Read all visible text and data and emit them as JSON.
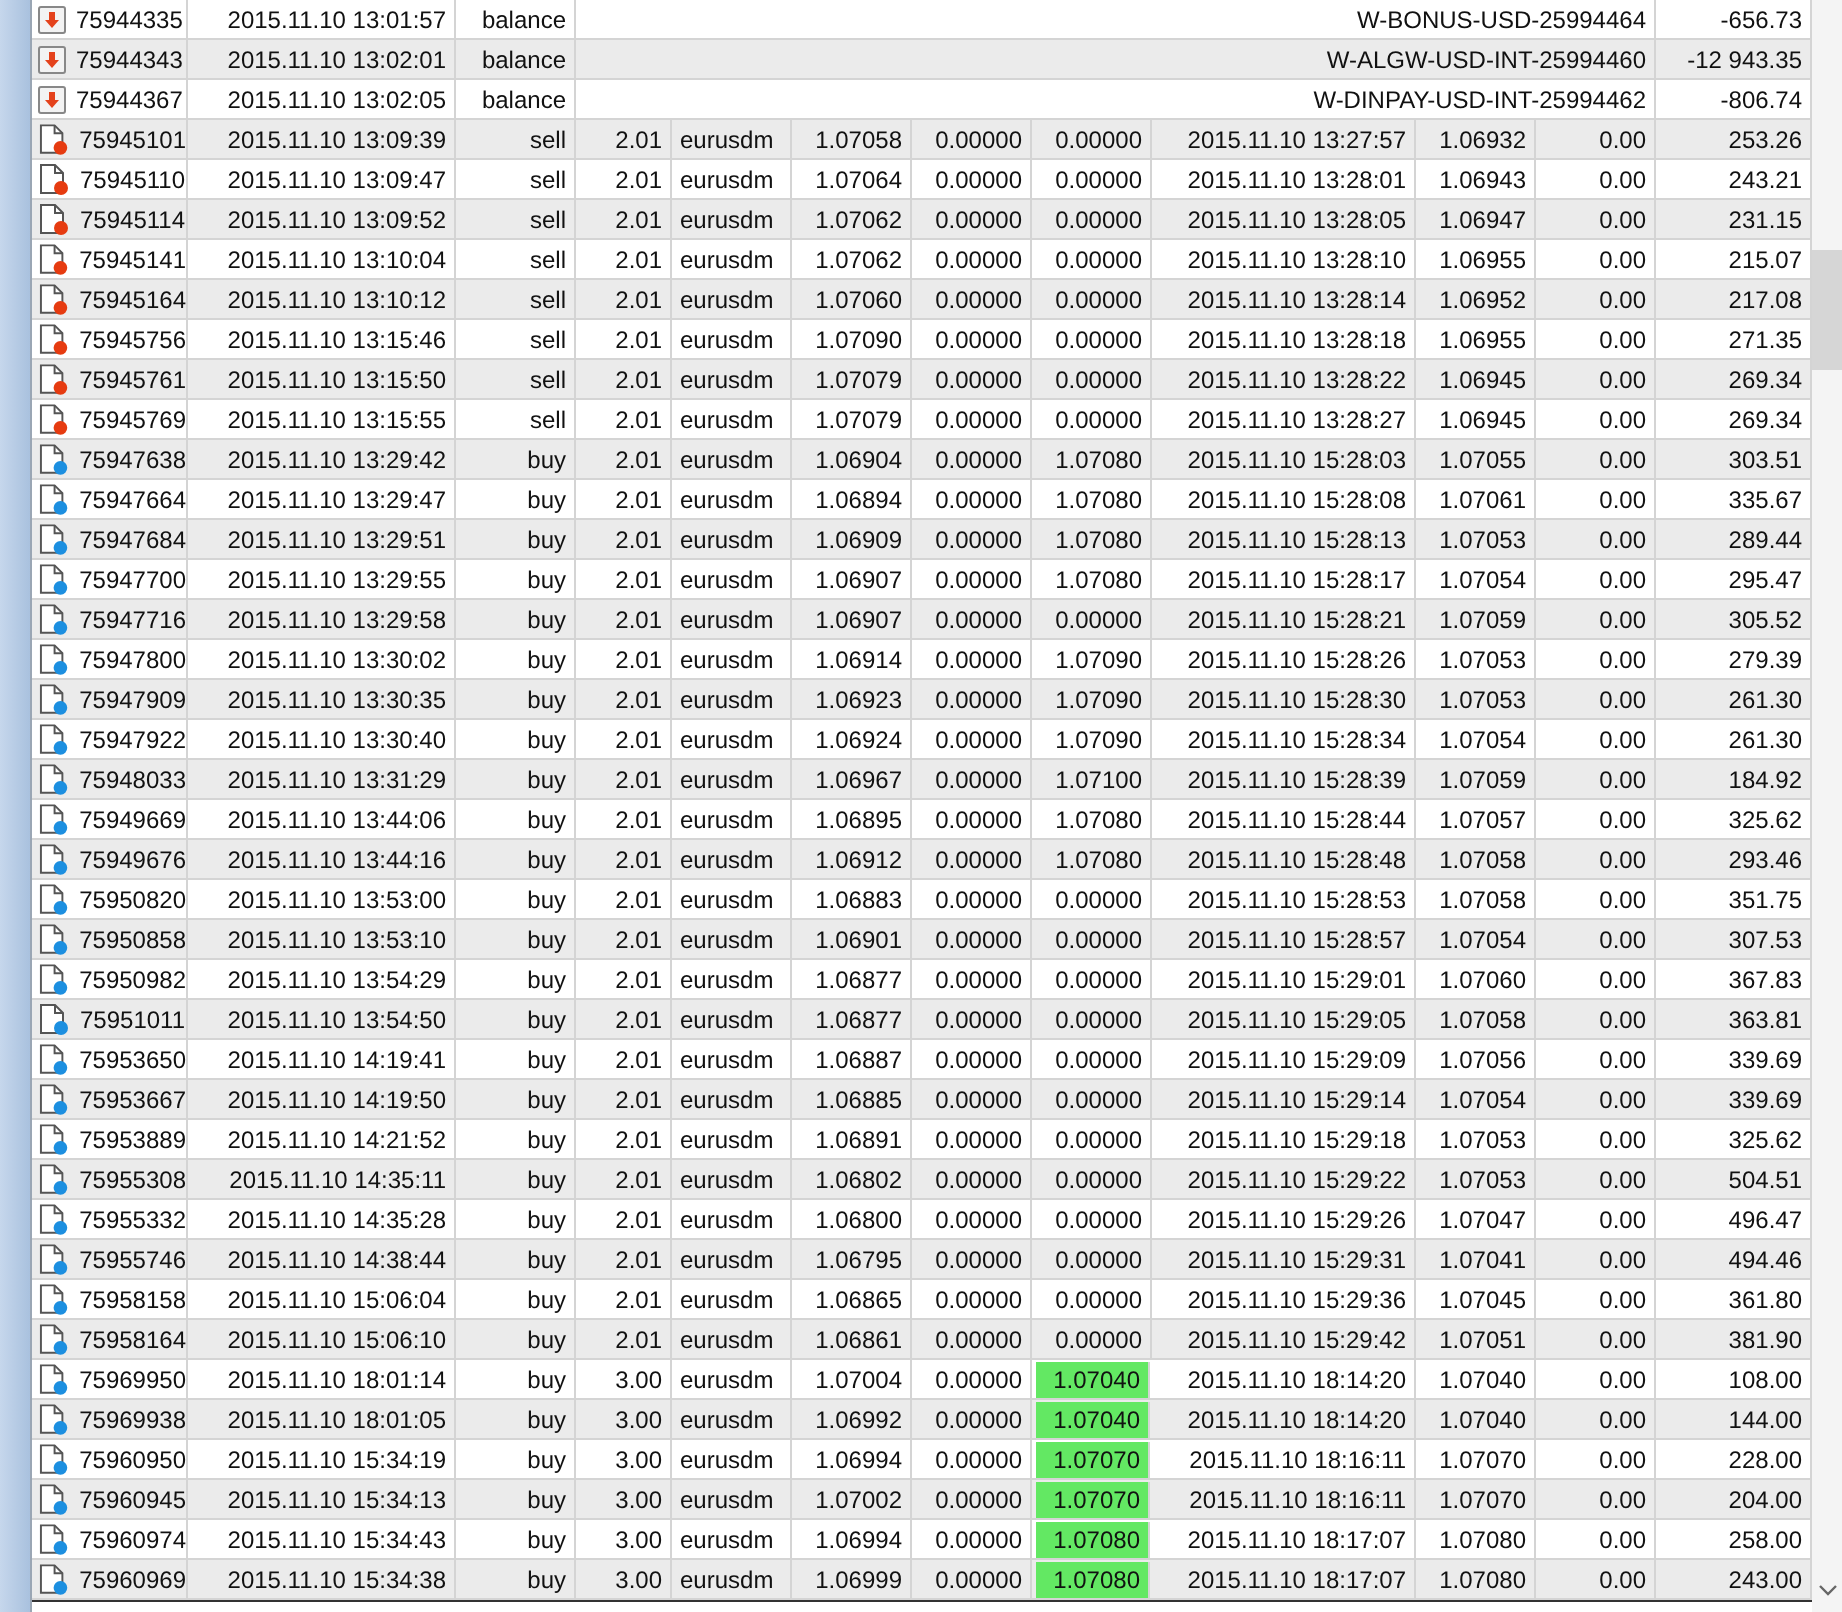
{
  "rows": [
    {
      "kind": "balance",
      "cells": [
        "75944335",
        "2015.11.10 13:01:57",
        "balance",
        "W-BONUS-USD-25994464",
        "-656.73"
      ]
    },
    {
      "kind": "balance",
      "cells": [
        "75944343",
        "2015.11.10 13:02:01",
        "balance",
        "W-ALGW-USD-INT-25994460",
        "-12 943.35"
      ]
    },
    {
      "kind": "balance",
      "cells": [
        "75944367",
        "2015.11.10 13:02:05",
        "balance",
        "W-DINPAY-USD-INT-25994462",
        "-806.74"
      ]
    },
    {
      "kind": "sell",
      "tp_highlighted": false,
      "cells": [
        "75945101",
        "2015.11.10 13:09:39",
        "sell",
        "2.01",
        "eurusdm",
        "1.07058",
        "0.00000",
        "0.00000",
        "2015.11.10 13:27:57",
        "1.06932",
        "0.00",
        "253.26"
      ]
    },
    {
      "kind": "sell",
      "tp_highlighted": false,
      "cells": [
        "75945110",
        "2015.11.10 13:09:47",
        "sell",
        "2.01",
        "eurusdm",
        "1.07064",
        "0.00000",
        "0.00000",
        "2015.11.10 13:28:01",
        "1.06943",
        "0.00",
        "243.21"
      ]
    },
    {
      "kind": "sell",
      "tp_highlighted": false,
      "cells": [
        "75945114",
        "2015.11.10 13:09:52",
        "sell",
        "2.01",
        "eurusdm",
        "1.07062",
        "0.00000",
        "0.00000",
        "2015.11.10 13:28:05",
        "1.06947",
        "0.00",
        "231.15"
      ]
    },
    {
      "kind": "sell",
      "tp_highlighted": false,
      "cells": [
        "75945141",
        "2015.11.10 13:10:04",
        "sell",
        "2.01",
        "eurusdm",
        "1.07062",
        "0.00000",
        "0.00000",
        "2015.11.10 13:28:10",
        "1.06955",
        "0.00",
        "215.07"
      ]
    },
    {
      "kind": "sell",
      "tp_highlighted": false,
      "cells": [
        "75945164",
        "2015.11.10 13:10:12",
        "sell",
        "2.01",
        "eurusdm",
        "1.07060",
        "0.00000",
        "0.00000",
        "2015.11.10 13:28:14",
        "1.06952",
        "0.00",
        "217.08"
      ]
    },
    {
      "kind": "sell",
      "tp_highlighted": false,
      "cells": [
        "75945756",
        "2015.11.10 13:15:46",
        "sell",
        "2.01",
        "eurusdm",
        "1.07090",
        "0.00000",
        "0.00000",
        "2015.11.10 13:28:18",
        "1.06955",
        "0.00",
        "271.35"
      ]
    },
    {
      "kind": "sell",
      "tp_highlighted": false,
      "cells": [
        "75945761",
        "2015.11.10 13:15:50",
        "sell",
        "2.01",
        "eurusdm",
        "1.07079",
        "0.00000",
        "0.00000",
        "2015.11.10 13:28:22",
        "1.06945",
        "0.00",
        "269.34"
      ]
    },
    {
      "kind": "sell",
      "tp_highlighted": false,
      "cells": [
        "75945769",
        "2015.11.10 13:15:55",
        "sell",
        "2.01",
        "eurusdm",
        "1.07079",
        "0.00000",
        "0.00000",
        "2015.11.10 13:28:27",
        "1.06945",
        "0.00",
        "269.34"
      ]
    },
    {
      "kind": "buy",
      "tp_highlighted": false,
      "cells": [
        "75947638",
        "2015.11.10 13:29:42",
        "buy",
        "2.01",
        "eurusdm",
        "1.06904",
        "0.00000",
        "1.07080",
        "2015.11.10 15:28:03",
        "1.07055",
        "0.00",
        "303.51"
      ]
    },
    {
      "kind": "buy",
      "tp_highlighted": false,
      "cells": [
        "75947664",
        "2015.11.10 13:29:47",
        "buy",
        "2.01",
        "eurusdm",
        "1.06894",
        "0.00000",
        "1.07080",
        "2015.11.10 15:28:08",
        "1.07061",
        "0.00",
        "335.67"
      ]
    },
    {
      "kind": "buy",
      "tp_highlighted": false,
      "cells": [
        "75947684",
        "2015.11.10 13:29:51",
        "buy",
        "2.01",
        "eurusdm",
        "1.06909",
        "0.00000",
        "1.07080",
        "2015.11.10 15:28:13",
        "1.07053",
        "0.00",
        "289.44"
      ]
    },
    {
      "kind": "buy",
      "tp_highlighted": false,
      "cells": [
        "75947700",
        "2015.11.10 13:29:55",
        "buy",
        "2.01",
        "eurusdm",
        "1.06907",
        "0.00000",
        "1.07080",
        "2015.11.10 15:28:17",
        "1.07054",
        "0.00",
        "295.47"
      ]
    },
    {
      "kind": "buy",
      "tp_highlighted": false,
      "cells": [
        "75947716",
        "2015.11.10 13:29:58",
        "buy",
        "2.01",
        "eurusdm",
        "1.06907",
        "0.00000",
        "0.00000",
        "2015.11.10 15:28:21",
        "1.07059",
        "0.00",
        "305.52"
      ]
    },
    {
      "kind": "buy",
      "tp_highlighted": false,
      "cells": [
        "75947800",
        "2015.11.10 13:30:02",
        "buy",
        "2.01",
        "eurusdm",
        "1.06914",
        "0.00000",
        "1.07090",
        "2015.11.10 15:28:26",
        "1.07053",
        "0.00",
        "279.39"
      ]
    },
    {
      "kind": "buy",
      "tp_highlighted": false,
      "cells": [
        "75947909",
        "2015.11.10 13:30:35",
        "buy",
        "2.01",
        "eurusdm",
        "1.06923",
        "0.00000",
        "1.07090",
        "2015.11.10 15:28:30",
        "1.07053",
        "0.00",
        "261.30"
      ]
    },
    {
      "kind": "buy",
      "tp_highlighted": false,
      "cells": [
        "75947922",
        "2015.11.10 13:30:40",
        "buy",
        "2.01",
        "eurusdm",
        "1.06924",
        "0.00000",
        "1.07090",
        "2015.11.10 15:28:34",
        "1.07054",
        "0.00",
        "261.30"
      ]
    },
    {
      "kind": "buy",
      "tp_highlighted": false,
      "cells": [
        "75948033",
        "2015.11.10 13:31:29",
        "buy",
        "2.01",
        "eurusdm",
        "1.06967",
        "0.00000",
        "1.07100",
        "2015.11.10 15:28:39",
        "1.07059",
        "0.00",
        "184.92"
      ]
    },
    {
      "kind": "buy",
      "tp_highlighted": false,
      "cells": [
        "75949669",
        "2015.11.10 13:44:06",
        "buy",
        "2.01",
        "eurusdm",
        "1.06895",
        "0.00000",
        "1.07080",
        "2015.11.10 15:28:44",
        "1.07057",
        "0.00",
        "325.62"
      ]
    },
    {
      "kind": "buy",
      "tp_highlighted": false,
      "cells": [
        "75949676",
        "2015.11.10 13:44:16",
        "buy",
        "2.01",
        "eurusdm",
        "1.06912",
        "0.00000",
        "1.07080",
        "2015.11.10 15:28:48",
        "1.07058",
        "0.00",
        "293.46"
      ]
    },
    {
      "kind": "buy",
      "tp_highlighted": false,
      "cells": [
        "75950820",
        "2015.11.10 13:53:00",
        "buy",
        "2.01",
        "eurusdm",
        "1.06883",
        "0.00000",
        "0.00000",
        "2015.11.10 15:28:53",
        "1.07058",
        "0.00",
        "351.75"
      ]
    },
    {
      "kind": "buy",
      "tp_highlighted": false,
      "cells": [
        "75950858",
        "2015.11.10 13:53:10",
        "buy",
        "2.01",
        "eurusdm",
        "1.06901",
        "0.00000",
        "0.00000",
        "2015.11.10 15:28:57",
        "1.07054",
        "0.00",
        "307.53"
      ]
    },
    {
      "kind": "buy",
      "tp_highlighted": false,
      "cells": [
        "75950982",
        "2015.11.10 13:54:29",
        "buy",
        "2.01",
        "eurusdm",
        "1.06877",
        "0.00000",
        "0.00000",
        "2015.11.10 15:29:01",
        "1.07060",
        "0.00",
        "367.83"
      ]
    },
    {
      "kind": "buy",
      "tp_highlighted": false,
      "cells": [
        "75951011",
        "2015.11.10 13:54:50",
        "buy",
        "2.01",
        "eurusdm",
        "1.06877",
        "0.00000",
        "0.00000",
        "2015.11.10 15:29:05",
        "1.07058",
        "0.00",
        "363.81"
      ]
    },
    {
      "kind": "buy",
      "tp_highlighted": false,
      "cells": [
        "75953650",
        "2015.11.10 14:19:41",
        "buy",
        "2.01",
        "eurusdm",
        "1.06887",
        "0.00000",
        "0.00000",
        "2015.11.10 15:29:09",
        "1.07056",
        "0.00",
        "339.69"
      ]
    },
    {
      "kind": "buy",
      "tp_highlighted": false,
      "cells": [
        "75953667",
        "2015.11.10 14:19:50",
        "buy",
        "2.01",
        "eurusdm",
        "1.06885",
        "0.00000",
        "0.00000",
        "2015.11.10 15:29:14",
        "1.07054",
        "0.00",
        "339.69"
      ]
    },
    {
      "kind": "buy",
      "tp_highlighted": false,
      "cells": [
        "75953889",
        "2015.11.10 14:21:52",
        "buy",
        "2.01",
        "eurusdm",
        "1.06891",
        "0.00000",
        "0.00000",
        "2015.11.10 15:29:18",
        "1.07053",
        "0.00",
        "325.62"
      ]
    },
    {
      "kind": "buy",
      "tp_highlighted": false,
      "cells": [
        "75955308",
        "2015.11.10 14:35:11",
        "buy",
        "2.01",
        "eurusdm",
        "1.06802",
        "0.00000",
        "0.00000",
        "2015.11.10 15:29:22",
        "1.07053",
        "0.00",
        "504.51"
      ]
    },
    {
      "kind": "buy",
      "tp_highlighted": false,
      "cells": [
        "75955332",
        "2015.11.10 14:35:28",
        "buy",
        "2.01",
        "eurusdm",
        "1.06800",
        "0.00000",
        "0.00000",
        "2015.11.10 15:29:26",
        "1.07047",
        "0.00",
        "496.47"
      ]
    },
    {
      "kind": "buy",
      "tp_highlighted": false,
      "cells": [
        "75955746",
        "2015.11.10 14:38:44",
        "buy",
        "2.01",
        "eurusdm",
        "1.06795",
        "0.00000",
        "0.00000",
        "2015.11.10 15:29:31",
        "1.07041",
        "0.00",
        "494.46"
      ]
    },
    {
      "kind": "buy",
      "tp_highlighted": false,
      "cells": [
        "75958158",
        "2015.11.10 15:06:04",
        "buy",
        "2.01",
        "eurusdm",
        "1.06865",
        "0.00000",
        "0.00000",
        "2015.11.10 15:29:36",
        "1.07045",
        "0.00",
        "361.80"
      ]
    },
    {
      "kind": "buy",
      "tp_highlighted": false,
      "cells": [
        "75958164",
        "2015.11.10 15:06:10",
        "buy",
        "2.01",
        "eurusdm",
        "1.06861",
        "0.00000",
        "0.00000",
        "2015.11.10 15:29:42",
        "1.07051",
        "0.00",
        "381.90"
      ]
    },
    {
      "kind": "buy",
      "tp_highlighted": true,
      "cells": [
        "75969950",
        "2015.11.10 18:01:14",
        "buy",
        "3.00",
        "eurusdm",
        "1.07004",
        "0.00000",
        "1.07040",
        "2015.11.10 18:14:20",
        "1.07040",
        "0.00",
        "108.00"
      ]
    },
    {
      "kind": "buy",
      "tp_highlighted": true,
      "cells": [
        "75969938",
        "2015.11.10 18:01:05",
        "buy",
        "3.00",
        "eurusdm",
        "1.06992",
        "0.00000",
        "1.07040",
        "2015.11.10 18:14:20",
        "1.07040",
        "0.00",
        "144.00"
      ]
    },
    {
      "kind": "buy",
      "tp_highlighted": true,
      "cells": [
        "75960950",
        "2015.11.10 15:34:19",
        "buy",
        "3.00",
        "eurusdm",
        "1.06994",
        "0.00000",
        "1.07070",
        "2015.11.10 18:16:11",
        "1.07070",
        "0.00",
        "228.00"
      ]
    },
    {
      "kind": "buy",
      "tp_highlighted": true,
      "cells": [
        "75960945",
        "2015.11.10 15:34:13",
        "buy",
        "3.00",
        "eurusdm",
        "1.07002",
        "0.00000",
        "1.07070",
        "2015.11.10 18:16:11",
        "1.07070",
        "0.00",
        "204.00"
      ]
    },
    {
      "kind": "buy",
      "tp_highlighted": true,
      "cells": [
        "75960974",
        "2015.11.10 15:34:43",
        "buy",
        "3.00",
        "eurusdm",
        "1.06994",
        "0.00000",
        "1.07080",
        "2015.11.10 18:17:07",
        "1.07080",
        "0.00",
        "258.00"
      ]
    },
    {
      "kind": "buy",
      "tp_highlighted": true,
      "cells": [
        "75960969",
        "2015.11.10 15:34:38",
        "buy",
        "3.00",
        "eurusdm",
        "1.06999",
        "0.00000",
        "1.07080",
        "2015.11.10 18:17:07",
        "1.07080",
        "0.00",
        "243.00"
      ]
    }
  ]
}
